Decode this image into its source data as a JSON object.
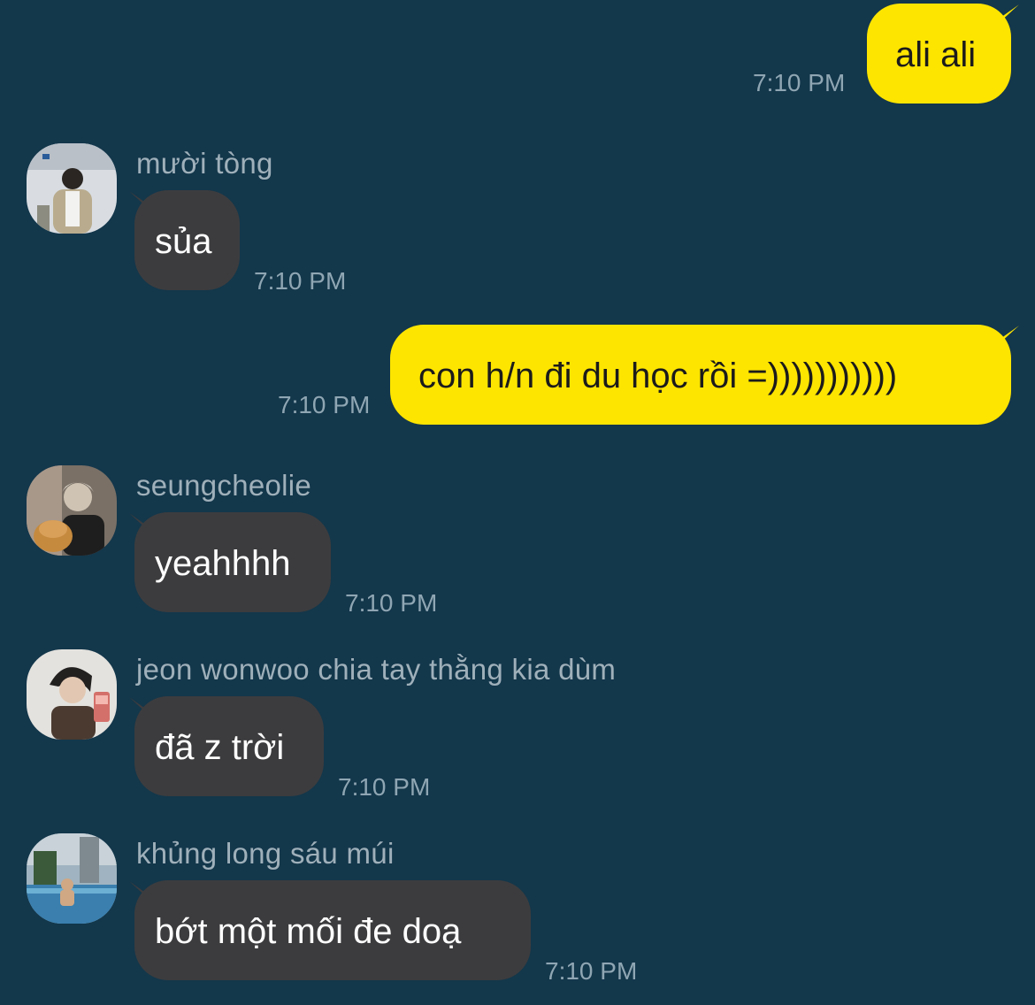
{
  "colors": {
    "background": "#13374b",
    "outgoing_bubble": "#fee500",
    "incoming_bubble": "#3c3c3e",
    "timestamp": "#8fa6b3",
    "sender_name": "#9fb0ba"
  },
  "messages": [
    {
      "direction": "outgoing",
      "text": "ali ali",
      "time": "7:10 PM"
    },
    {
      "direction": "incoming",
      "sender": "mười tòng",
      "avatar_icon": "profile-photo-icon",
      "text": "sủa",
      "time": "7:10 PM"
    },
    {
      "direction": "outgoing",
      "text": "con h/n đi du học rồi =)))))))))))",
      "time": "7:10 PM"
    },
    {
      "direction": "incoming",
      "sender": "seungcheolie",
      "avatar_icon": "profile-photo-icon",
      "text": "yeahhhh",
      "time": "7:10 PM"
    },
    {
      "direction": "incoming",
      "sender": "jeon wonwoo chia tay thằng kia dùm",
      "avatar_icon": "profile-photo-icon",
      "text": "đã z trời",
      "time": "7:10 PM"
    },
    {
      "direction": "incoming",
      "sender": "khủng long sáu múi",
      "avatar_icon": "profile-photo-icon",
      "text": "bớt một mối đe doạ",
      "time": "7:10 PM"
    }
  ]
}
